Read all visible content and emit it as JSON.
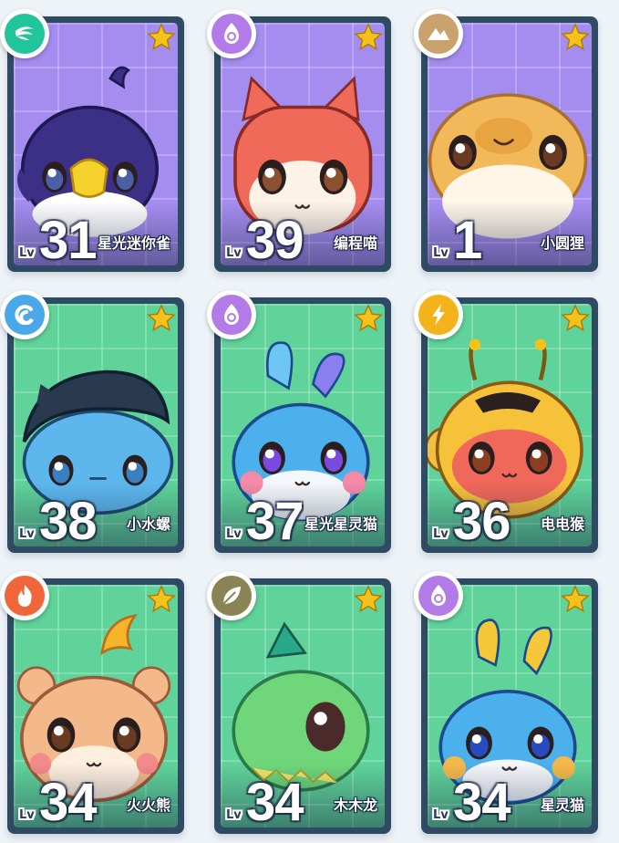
{
  "level_prefix": "Lv",
  "pets": [
    {
      "name": "星光迷你雀",
      "level": "31",
      "element": "wind",
      "border": "#2f4b63",
      "bg": "#a58df0",
      "star_color": "#f5c21b"
    },
    {
      "name": "编程喵",
      "level": "39",
      "element": "star",
      "border": "#2f4b63",
      "bg": "#a58df0",
      "star_color": "#f5c21b"
    },
    {
      "name": "小圆狸",
      "level": "1",
      "element": "earth",
      "border": "#2f4b63",
      "bg": "#a58df0",
      "star_color": "#f5c21b"
    },
    {
      "name": "小水螺",
      "level": "38",
      "element": "water",
      "border": "#2f4b63",
      "bg": "#5fd39a",
      "star_color": "#f5c21b"
    },
    {
      "name": "星光星灵猫",
      "level": "37",
      "element": "star",
      "border": "#2f4b63",
      "bg": "#5fd39a",
      "star_color": "#f5c21b"
    },
    {
      "name": "电电猴",
      "level": "36",
      "element": "electric",
      "border": "#2f4b63",
      "bg": "#5fd39a",
      "star_color": "#f5c21b"
    },
    {
      "name": "火火熊",
      "level": "34",
      "element": "fire",
      "border": "#2f4b63",
      "bg": "#5fd39a",
      "star_color": "#f5c21b"
    },
    {
      "name": "木木龙",
      "level": "34",
      "element": "grass",
      "border": "#2f4b63",
      "bg": "#5fd39a",
      "star_color": "#f5c21b"
    },
    {
      "name": "星灵猫",
      "level": "34",
      "element": "star",
      "border": "#2f4b63",
      "bg": "#5fd39a",
      "star_color": "#f5c21b"
    }
  ],
  "element_colors": {
    "wind": "#22c49a",
    "star": "#b37be8",
    "earth": "#c9a26e",
    "water": "#4aa7e8",
    "electric": "#f5b31b",
    "fire": "#f0653a",
    "grass": "#8a8455"
  }
}
